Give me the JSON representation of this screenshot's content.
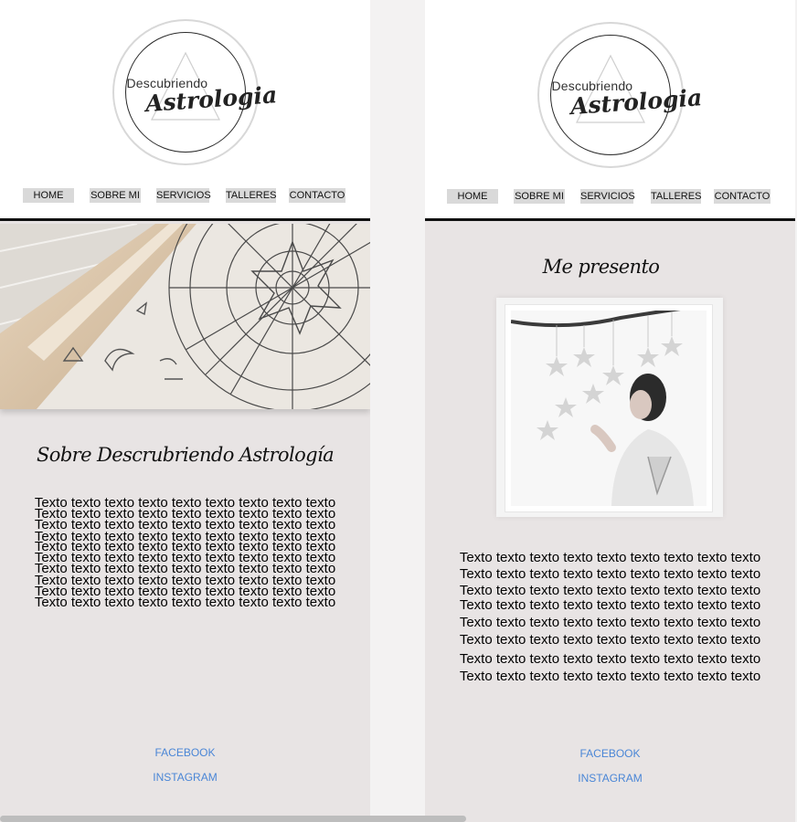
{
  "logo": {
    "line1": "Descubriendo",
    "line2": "Astrologia"
  },
  "nav": [
    "HOME",
    "SOBRE MI",
    "SERVICIOS",
    "TALLERES",
    "CONTACTO"
  ],
  "page1": {
    "heading": "Sobre Descrubriendo Astrología",
    "paragraph_lines": [
      "Texto texto texto texto texto texto texto texto texto",
      "Texto texto texto texto texto texto texto texto texto",
      "Texto texto texto texto texto texto texto texto texto",
      "Texto texto texto texto texto texto texto texto texto",
      "Texto texto texto texto texto texto texto texto texto",
      "Texto texto texto texto texto texto texto texto texto",
      "Texto texto texto texto texto texto texto texto texto",
      "Texto texto texto texto texto texto texto texto texto",
      "Texto texto texto texto texto texto texto texto texto",
      "Texto texto texto texto texto texto texto texto texto"
    ],
    "social": {
      "facebook": "FACEBOOK",
      "instagram": "INSTAGRAM"
    }
  },
  "page2": {
    "heading": "Me presento",
    "paragraph_lines": [
      "Texto texto texto texto texto texto texto texto texto",
      "Texto texto texto texto texto texto texto texto texto",
      "Texto texto texto texto texto texto texto texto texto",
      "Texto texto texto texto texto texto texto texto texto",
      "Texto texto texto texto texto texto texto texto texto",
      "Texto texto texto texto texto texto texto texto texto",
      "Texto texto texto texto texto texto texto texto texto",
      "Texto texto texto texto texto texto texto texto texto"
    ],
    "social": {
      "facebook": "FACEBOOK",
      "instagram": "INSTAGRAM"
    }
  },
  "colors": {
    "page_bg": "#e8e4e4",
    "header_bg": "#ffffff",
    "link": "#4a86d6",
    "nav_bg": "#d9d9d9"
  }
}
